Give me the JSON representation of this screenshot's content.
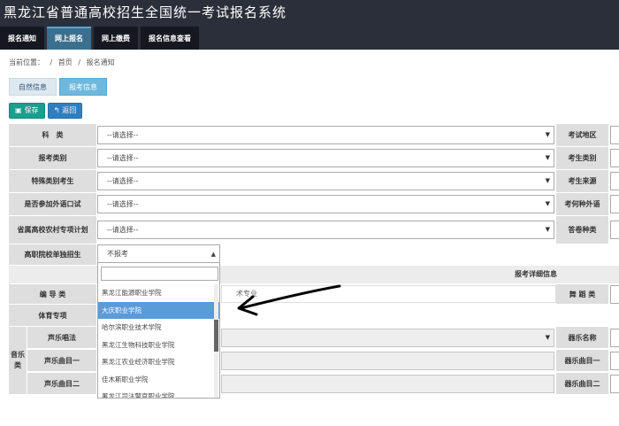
{
  "app": {
    "title": "黑龙江省普通高校招生全国统一考试报名系统"
  },
  "nav": {
    "tabs": [
      "报名通知",
      "网上报名",
      "网上缴费",
      "报名信息查看"
    ]
  },
  "breadcrumb": {
    "prefix": "当前位置：",
    "home": "首页",
    "current": "报名通知"
  },
  "subtabs": [
    "自然信息",
    "报考信息"
  ],
  "buttons": {
    "save": "保存",
    "back": "返回"
  },
  "form": {
    "kelei": {
      "label": "科　类",
      "value": "--请选择--",
      "right_label": "考试地区"
    },
    "baokao_leibie": {
      "label": "报考类别",
      "value": "--请选择--",
      "right_label": "考生类别"
    },
    "teshu": {
      "label": "特殊类别考生",
      "value": "--请选择--",
      "right_label": "考生来源"
    },
    "waiyu": {
      "label": "是否参加外语口试",
      "value": "--请选择--",
      "right_label": "考何种外语"
    },
    "nongcun": {
      "label": "省属高校农村专项计划",
      "value": "--请选择--",
      "right_label": "答卷种类"
    },
    "gaozhi": {
      "label": "高职院校单独招生",
      "value": "不报考"
    }
  },
  "section": {
    "title": "报考详细信息"
  },
  "detail": {
    "bianhao": {
      "label": "编 导 类",
      "value": "术专业",
      "right_label": "舞 蹈 类"
    },
    "tiyu": {
      "label": "体育专项"
    },
    "yinyue": {
      "side_label": "音乐类",
      "changfa": {
        "label": "声乐唱法",
        "right_label": "器乐名称"
      },
      "qumu1": {
        "label": "声乐曲目一",
        "right_label": "器乐曲目一"
      },
      "qumu2": {
        "label": "声乐曲目二",
        "right_label": "器乐曲目二"
      }
    }
  },
  "dropdown": {
    "search_value": "",
    "options": [
      "黑龙江能源职业学院",
      "大庆职业学院",
      "哈尔滨职业技术学院",
      "黑龙江生物科技职业学院",
      "黑龙江农业经济职业学院",
      "佳木斯职业学院",
      "黑龙江司法警官职业学院"
    ],
    "highlighted": "大庆职业学院"
  },
  "colors": {
    "topbar": "#2b2f3a",
    "active_tab": "#3a6f8f",
    "highlight": "#5b9bd8",
    "save_button": "#1a9e8e",
    "back_button": "#2f7fc0"
  }
}
